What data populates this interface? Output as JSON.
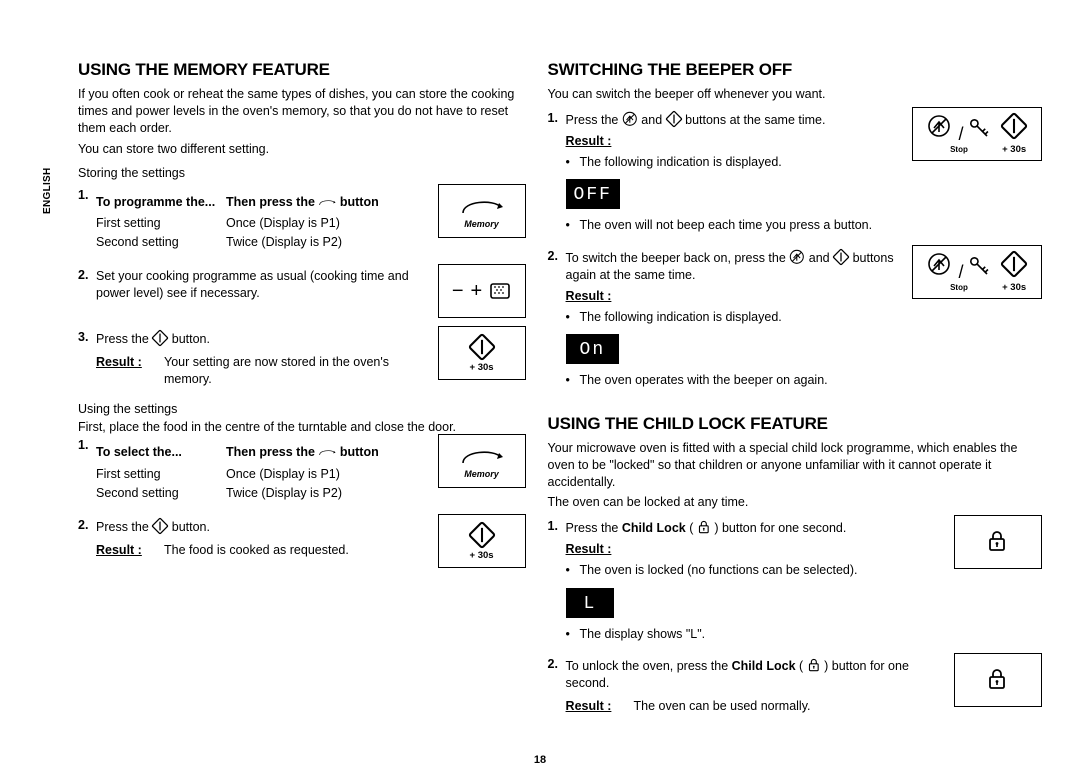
{
  "page_number": "18",
  "language_tab": "ENGLISH",
  "left": {
    "h_memory": "USING THE MEMORY FEATURE",
    "memory_intro": "If you often cook or reheat the same types of dishes, you can store the cooking times and power levels in the oven's memory, so that you do not have to reset them each order.",
    "memory_intro2": "You can store two different setting.",
    "storing_label": "Storing the settings",
    "tbl1_h1": "To programme the...",
    "tbl1_h2a": "Then press the ",
    "tbl1_h2b": " button",
    "tbl1_r1c1": "First setting",
    "tbl1_r1c2": "Once (Display is P1)",
    "tbl1_r2c1": "Second setting",
    "tbl1_r2c2": "Twice (Display is P2)",
    "step2": "Set your cooking programme as usual (cooking time and power level) see if necessary.",
    "step3a": "Press the ",
    "step3b": " button.",
    "result_label": "Result :",
    "step3_result": "Your setting are now stored in the oven's memory.",
    "plus30s": "+ 30s",
    "using_label": "Using the settings",
    "using_intro": "First, place the food in the centre of the turntable and close the door.",
    "tbl2_h1": "To select the...",
    "tbl2_h2a": "Then press the ",
    "tbl2_h2b": " button",
    "tbl2_r1c1": "First setting",
    "tbl2_r1c2": "Once (Display is P1)",
    "tbl2_r2c1": "Second setting",
    "tbl2_r2c2": "Twice (Display is P2)",
    "u_step2a": "Press the ",
    "u_step2b": " button.",
    "u_step2_result": "The food is cooked as requested.",
    "memory_btn_label": "Memory",
    "stop_label": "Stop"
  },
  "right": {
    "h_beeper": "SWITCHING THE BEEPER OFF",
    "beeper_intro": "You can switch the beeper off whenever you want.",
    "b_step1a": "Press the ",
    "b_step1b": " and ",
    "b_step1c": " buttons at the same time.",
    "b_res1_a": "The following indication is displayed.",
    "off_display": "OFF",
    "b_res1_b": "The oven will not beep each time you press a button.",
    "b_step2a": "To switch the beeper back on, press the ",
    "b_step2b": " and ",
    "b_step2c": " buttons again at the same time.",
    "b_res2_a": "The following indication is displayed.",
    "on_display": "On",
    "b_res2_b": "The oven operates with the beeper on again.",
    "h_lock": "USING THE CHILD LOCK FEATURE",
    "lock_intro": "Your microwave oven is fitted with a special child lock programme, which enables the oven to be \"locked\" so that children or anyone unfamiliar with it cannot operate it accidentally.",
    "lock_intro2": "The oven can be locked at any time.",
    "l_step1a": "Press the ",
    "l_step1b_bold": "Child Lock",
    "l_step1c": " ( ",
    "l_step1d": " ) button for one second.",
    "l_res1_a": "The oven is locked (no functions can be selected).",
    "l_display": "L",
    "l_res1_b": "The display shows \"L\".",
    "l_step2a": "To unlock the oven, press the ",
    "l_step2b_bold": "Child Lock",
    "l_step2c": " ( ",
    "l_step2d": " ) button for one second.",
    "l_step2_result": "The oven can be used normally."
  }
}
